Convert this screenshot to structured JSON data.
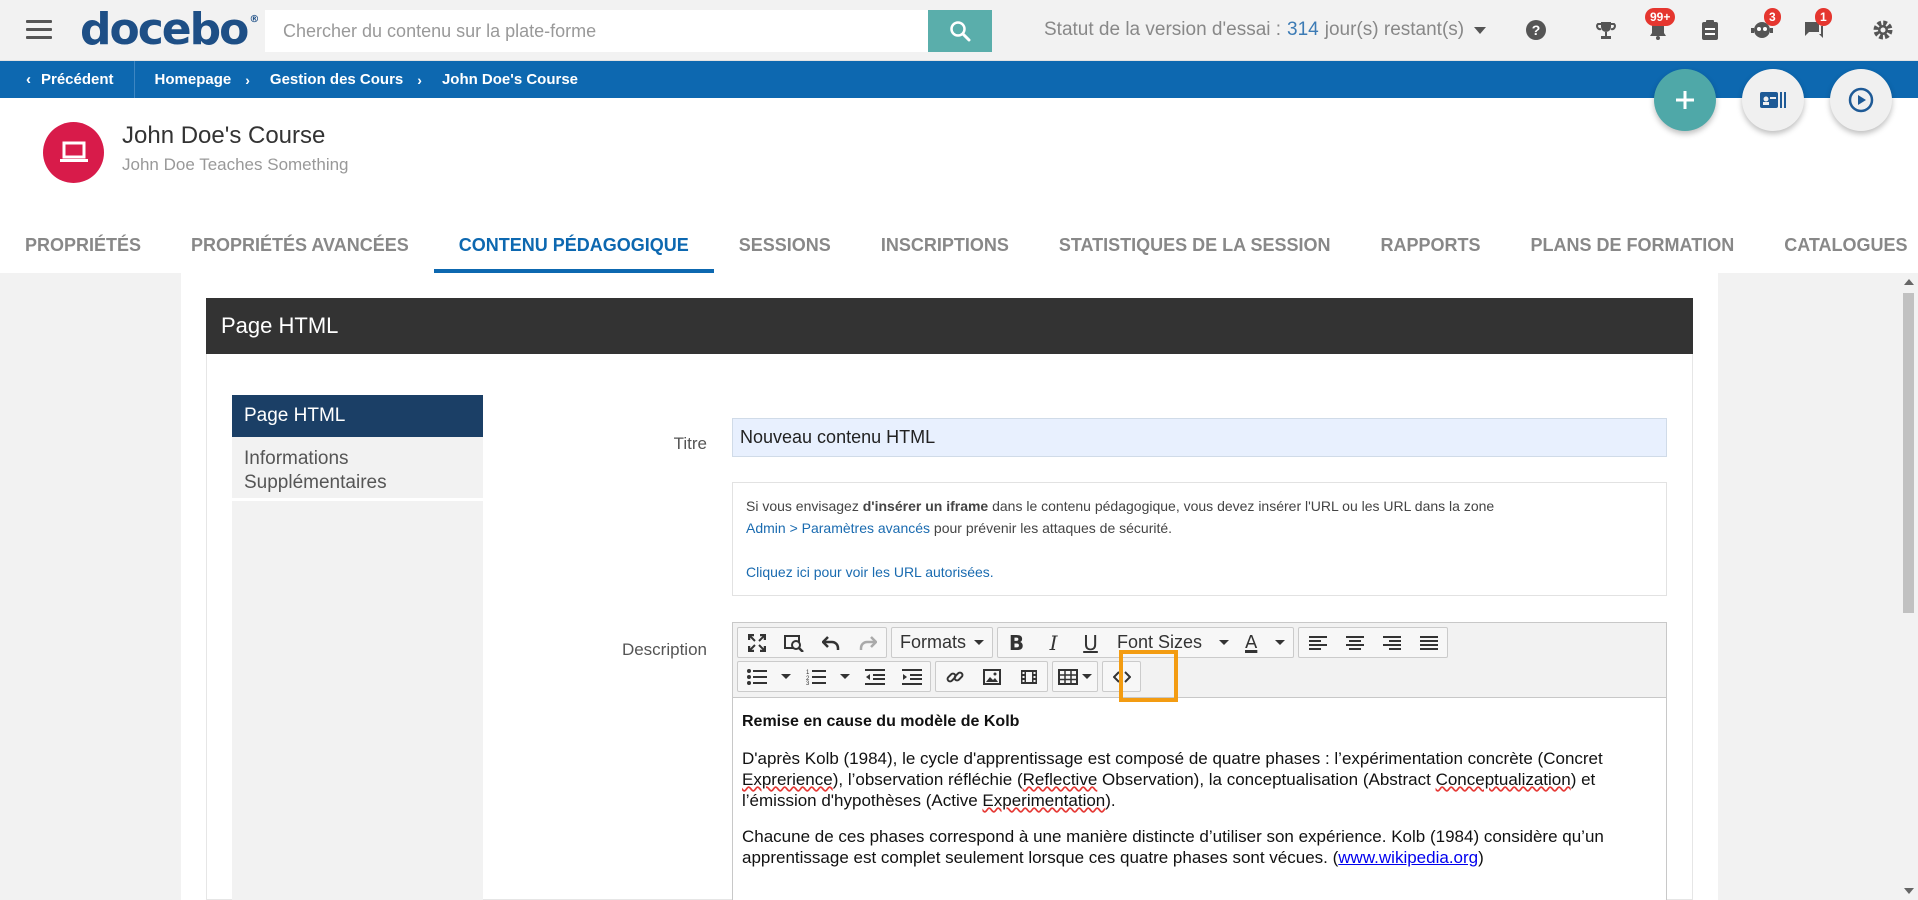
{
  "topbar": {
    "logo": "docebo",
    "logo_mark": "®",
    "search_placeholder": "Chercher du contenu sur la plate-forme",
    "trial_label": "Statut de la version d'essai :",
    "trial_days": "314",
    "trial_suffix": "jour(s) restant(s)",
    "badges": {
      "notifications": "99+",
      "users": "3",
      "messages": "1"
    }
  },
  "breadcrumb": {
    "back": "Précédent",
    "items": [
      "Homepage",
      "Gestion des Cours",
      "John Doe's Course"
    ]
  },
  "course": {
    "title": "John Doe's Course",
    "subtitle": "John Doe Teaches Something"
  },
  "tabs": [
    {
      "label": "PROPRIÉTÉS"
    },
    {
      "label": "PROPRIÉTÉS AVANCÉES"
    },
    {
      "label": "CONTENU PÉDAGOGIQUE"
    },
    {
      "label": "SESSIONS"
    },
    {
      "label": "INSCRIPTIONS"
    },
    {
      "label": "STATISTIQUES DE LA SESSION"
    },
    {
      "label": "RAPPORTS"
    },
    {
      "label": "PLANS DE FORMATION"
    },
    {
      "label": "CATALOGUES"
    }
  ],
  "tab_more": "•••",
  "panel": {
    "header": "Page HTML",
    "side_menu": [
      "Page HTML",
      "Informations Supplémentaires"
    ],
    "title_label": "Titre",
    "title_value": "Nouveau contenu HTML",
    "info": {
      "line1_a": "Si vous envisagez ",
      "line1_b": "d'insérer un iframe",
      "line1_c": " dans le contenu pédagogique, vous devez insérer l'URL ou les URL dans la zone",
      "line2_link": "Admin > Paramètres avancés",
      "line2_rest": " pour prévenir les attaques de sécurité.",
      "line3_link": "Cliquez ici pour voir les URL autorisées."
    },
    "description_label": "Description",
    "toolbar": {
      "formats": "Formats",
      "font_sizes": "Font Sizes"
    },
    "editor": {
      "heading": "Remise en cause du modèle de Kolb",
      "p1_a": "D'après Kolb (1984), le cycle d'apprentissage est composé de quatre phases : l’expérimentation concrète (Concret ",
      "p1_b": "Exprerience",
      "p1_c": "), l’observation réfléchie (",
      "p1_d": "Reflective",
      "p1_e": " Observation), la conceptualisation (Abstract ",
      "p1_f": "Conceptualization",
      "p1_g": ") et l’émission d'hypothèses (Active ",
      "p1_h": "Experimentation",
      "p1_i": ").",
      "p2_a": "Chacune de ces phases correspond à une manière distincte d’utiliser son expérience. Kolb (1984) considère qu’un apprentissage est complet seulement lorsque ces quatre phases sont vécues. (",
      "p2_link": "www.wikipedia.org",
      "p2_c": ")"
    }
  },
  "colors": {
    "brand": "#1e4f86",
    "crumb_bar": "#0d68b0",
    "search_button": "#5aaeab",
    "fab_add": "#4fa8a8",
    "active_tab": "#0d68b0",
    "highlight": "#f39c12",
    "badge": "#e5362f",
    "course_avatar": "#d81b4a"
  }
}
